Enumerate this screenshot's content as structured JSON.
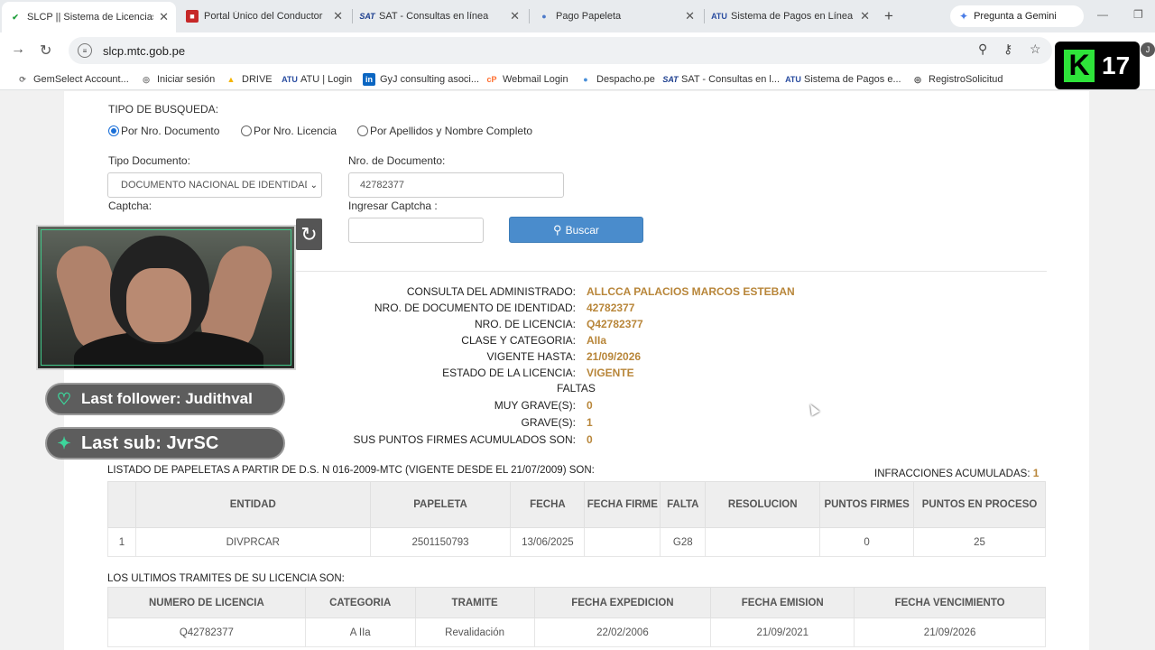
{
  "tabs": [
    {
      "label": "SLCP || Sistema de Licencias",
      "icon": "shield-check-icon",
      "active": true
    },
    {
      "label": "Portal Único del Conductor",
      "icon": "flag-icon"
    },
    {
      "label": "SAT - Consultas en línea",
      "icon": "sat-logo-icon"
    },
    {
      "label": "Pago Papeleta",
      "icon": "globe-icon"
    },
    {
      "label": "Sistema de Pagos en Línea",
      "icon": "atu-logo-icon"
    }
  ],
  "gemini_label": "Pregunta a Gemini",
  "address": {
    "url": "slcp.mtc.gob.pe"
  },
  "bookmarks": [
    {
      "label": "GemSelect Account..."
    },
    {
      "label": "Iniciar sesión"
    },
    {
      "label": "DRIVE"
    },
    {
      "label": "ATU | Login"
    },
    {
      "label": "GyJ consulting asoci..."
    },
    {
      "label": "Webmail Login"
    },
    {
      "label": "Despacho.pe"
    },
    {
      "label": "SAT - Consultas en l..."
    },
    {
      "label": "Sistema de Pagos e..."
    },
    {
      "label": "RegistroSolicitud"
    }
  ],
  "brand_badge": {
    "letter": "K",
    "number": "17"
  },
  "search": {
    "tipo_label": "TIPO DE BUSQUEDA:",
    "options": [
      "Por Nro. Documento",
      "Por Nro. Licencia",
      "Por Apellidos y Nombre Completo"
    ],
    "selected_option": 0,
    "tipo_doc_label": "Tipo Documento:",
    "tipo_doc_value": "DOCUMENTO NACIONAL DE IDENTIDAD",
    "nro_doc_label": "Nro. de Documento:",
    "nro_doc_value": "42782377",
    "captcha_label": "Captcha:",
    "ingresar_captcha_label": "Ingresar Captcha :",
    "buscar_label": "Buscar"
  },
  "result": {
    "rows": [
      {
        "k": "CONSULTA DEL ADMINISTRADO:",
        "v": "ALLCCA PALACIOS MARCOS ESTEBAN"
      },
      {
        "k": "NRO. DE DOCUMENTO DE IDENTIDAD:",
        "v": "42782377"
      },
      {
        "k": "NRO. DE LICENCIA:",
        "v": "Q42782377"
      },
      {
        "k": "CLASE Y CATEGORIA:",
        "v": "AIIa"
      },
      {
        "k": "VIGENTE HASTA:",
        "v": "21/09/2026"
      },
      {
        "k": "ESTADO DE LA LICENCIA:",
        "v": "VIGENTE"
      }
    ],
    "faltas_title": "FALTAS",
    "faltas": [
      {
        "k": "MUY GRAVE(S):",
        "v": "0"
      },
      {
        "k": "GRAVE(S):",
        "v": "1"
      },
      {
        "k": "SUS PUNTOS FIRMES ACUMULADOS SON:",
        "v": "0"
      }
    ]
  },
  "papeletas": {
    "title": "LISTADO DE PAPELETAS A PARTIR DE D.S. N 016-2009-MTC (VIGENTE DESDE EL 21/07/2009) SON:",
    "acumuladas_label": "INFRACCIONES ACUMULADAS:",
    "acumuladas_value": "1",
    "headers": [
      "",
      "ENTIDAD",
      "PAPELETA",
      "FECHA",
      "FECHA FIRME",
      "FALTA",
      "RESOLUCION",
      "PUNTOS FIRMES",
      "PUNTOS EN PROCESO"
    ],
    "rows": [
      [
        "1",
        "DIVPRCAR",
        "2501150793",
        "13/06/2025",
        "",
        "G28",
        "",
        "0",
        "25"
      ]
    ]
  },
  "tramites": {
    "title": "LOS ULTIMOS TRAMITES DE SU LICENCIA SON:",
    "headers": [
      "NUMERO DE LICENCIA",
      "CATEGORIA",
      "TRAMITE",
      "FECHA EXPEDICION",
      "FECHA EMISION",
      "FECHA VENCIMIENTO"
    ],
    "rows": [
      [
        "Q42782377",
        "A IIa",
        "Revalidación",
        "22/02/2006",
        "21/09/2021",
        "21/09/2026"
      ]
    ]
  },
  "overlay": {
    "follower": "Last follower: Judithval",
    "sub": "Last sub: JvrSC"
  }
}
